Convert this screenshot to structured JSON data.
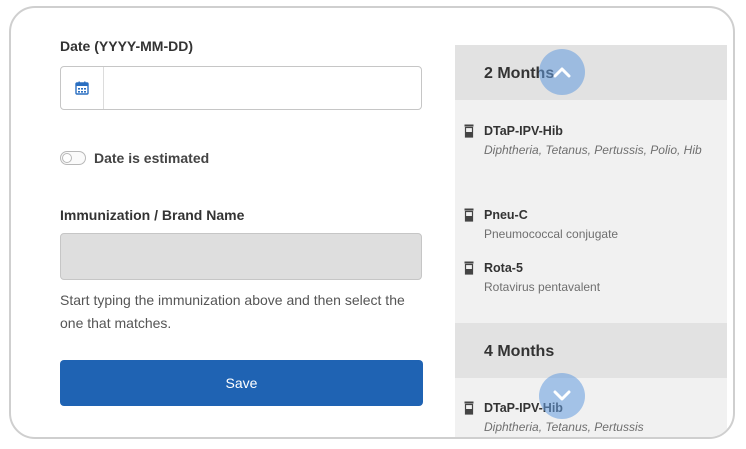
{
  "form": {
    "date_label": "Date (YYYY-MM-DD)",
    "date_value": "",
    "date_placeholder": "",
    "estimated_label": "Date is estimated",
    "estimated_checked": false,
    "brand_label": "Immunization / Brand Name",
    "brand_value": "",
    "brand_placeholder": "",
    "help_text": "Start typing the immunization above and then select the one that matches.",
    "save_label": "Save"
  },
  "schedule": {
    "groups": [
      {
        "title": "2 Months",
        "vaccines": [
          {
            "name": "DTaP-IPV-Hib",
            "description": "Diphtheria, Tetanus, Pertussis, Polio, Hib",
            "icon": "vaccine-vial-icon"
          },
          {
            "name": "Pneu-C",
            "description": "Pneumococcal conjugate",
            "icon": "vaccine-vial-icon"
          },
          {
            "name": "Rota-5",
            "description": "Rotavirus pentavalent",
            "icon": "vaccine-vial-icon"
          }
        ]
      },
      {
        "title": "4 Months",
        "vaccines": [
          {
            "name": "DTaP-IPV-Hib",
            "description": "Diphtheria, Tetanus, Pertussis",
            "icon": "vaccine-vial-icon"
          }
        ]
      }
    ],
    "scroll_up_icon": "chevron-up-icon",
    "scroll_down_icon": "chevron-down-icon"
  },
  "colors": {
    "primary": "#1f63b3",
    "scroll_button": "#629bde",
    "panel_bg": "#f1f1f1",
    "header_bg": "#e2e2e2"
  }
}
